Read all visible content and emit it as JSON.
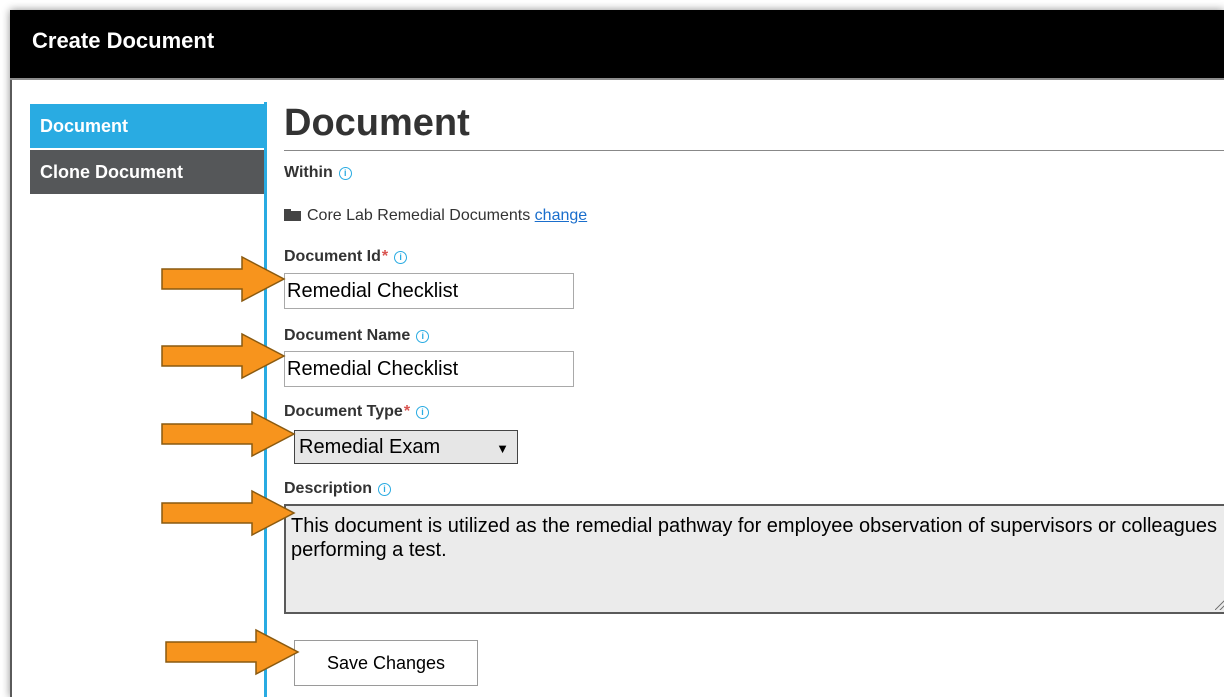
{
  "window": {
    "title": "Create Document"
  },
  "sidebar": {
    "items": [
      {
        "label": "Document",
        "active": true
      },
      {
        "label": "Clone Document",
        "active": false
      }
    ]
  },
  "main": {
    "heading": "Document",
    "within": {
      "label": "Within",
      "folder_name": "Core Lab Remedial Documents",
      "change_link": "change"
    },
    "document_id": {
      "label": "Document Id",
      "required_marker": "*",
      "value": "Remedial Checklist"
    },
    "document_name": {
      "label": "Document Name",
      "value": "Remedial Checklist"
    },
    "document_type": {
      "label": "Document Type",
      "required_marker": "*",
      "selected": "Remedial Exam"
    },
    "description": {
      "label": "Description",
      "value": "This document is utilized as the remedial pathway for employee observation of supervisors or colleagues performing a test."
    },
    "save_label": "Save Changes"
  },
  "icons": {
    "info": "info-circle-icon",
    "folder": "folder-open-icon",
    "caret": "caret-down-icon"
  },
  "colors": {
    "titlebar": "#000000",
    "accent_blue": "#29abe2",
    "nav_inactive": "#555759",
    "arrow_fill": "#f7941d",
    "required": "#d9534f",
    "link": "#1a6ecc"
  }
}
